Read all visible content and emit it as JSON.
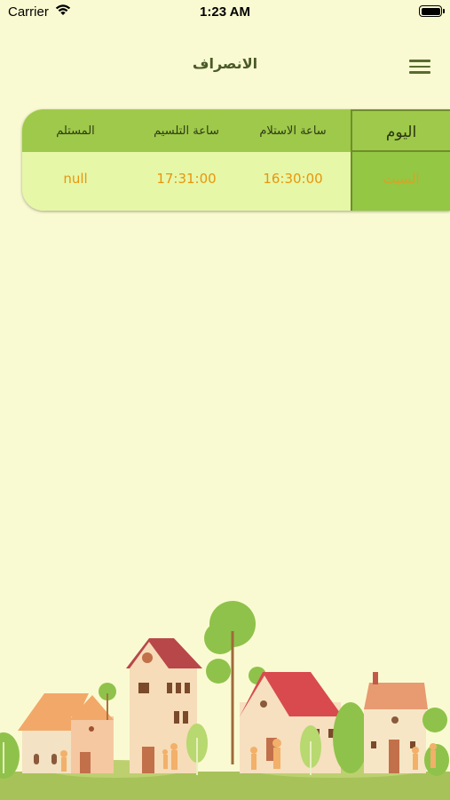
{
  "status_bar": {
    "carrier": "Carrier",
    "time": "1:23 AM"
  },
  "nav": {
    "title": "الانصراف",
    "menu_icon": "hamburger-menu-icon"
  },
  "table": {
    "headers": {
      "receiver": "المستلم",
      "delivery_time": "ساعة التلسيم",
      "receipt_time": "ساعة الاستلام",
      "day": "اليوم"
    },
    "row": {
      "receiver": "null",
      "delivery_time": "17:31:00",
      "receipt_time": "16:30:00",
      "day": "السبت"
    }
  },
  "colors": {
    "background": "#fafad2",
    "header_green": "#9ec94a",
    "row_light": "#e6f7a8",
    "value_orange": "#e8960c"
  }
}
